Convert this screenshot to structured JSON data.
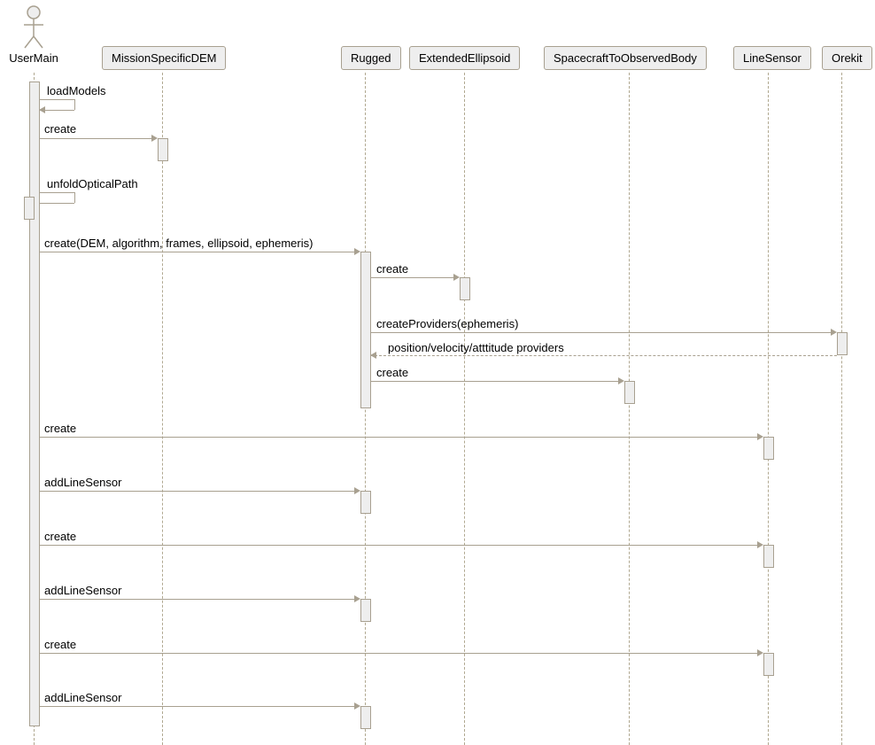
{
  "participants": {
    "userMain": "UserMain",
    "missionSpecificDEM": "MissionSpecificDEM",
    "rugged": "Rugged",
    "extendedEllipsoid": "ExtendedEllipsoid",
    "spacecraftToObservedBody": "SpacecraftToObservedBody",
    "lineSensor": "LineSensor",
    "orekit": "Orekit"
  },
  "messages": {
    "loadModels": "loadModels",
    "create1": "create",
    "unfoldOpticalPath": "unfoldOpticalPath",
    "createRugged": "create(DEM, algorithm, frames, ellipsoid, ephemeris)",
    "createEE": "create",
    "createProviders": "createProviders(ephemeris)",
    "providersReturn": "position/velocity/atttitude providers",
    "createSTOB": "create",
    "createLS1": "create",
    "addLS1": "addLineSensor",
    "createLS2": "create",
    "addLS2": "addLineSensor",
    "createLS3": "create",
    "addLS3": "addLineSensor"
  }
}
